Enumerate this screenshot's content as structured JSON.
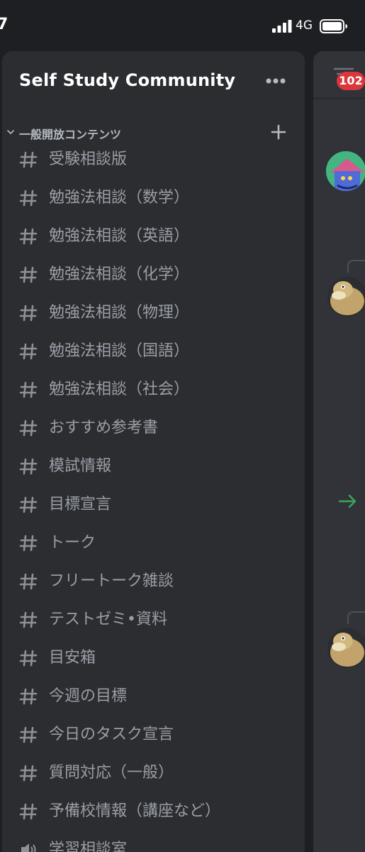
{
  "status_bar": {
    "time": "7",
    "network": "4G"
  },
  "server": {
    "name": "Self Study Community"
  },
  "category": {
    "label": "一般開放コンテンツ"
  },
  "channels": [
    {
      "label": "受験相談版",
      "type": "text"
    },
    {
      "label": "勉強法相談（数学）",
      "type": "text"
    },
    {
      "label": "勉強法相談（英語）",
      "type": "text"
    },
    {
      "label": "勉強法相談（化学）",
      "type": "text"
    },
    {
      "label": "勉強法相談（物理）",
      "type": "text"
    },
    {
      "label": "勉強法相談（国語）",
      "type": "text"
    },
    {
      "label": "勉強法相談（社会）",
      "type": "text"
    },
    {
      "label": "おすすめ参考書",
      "type": "text"
    },
    {
      "label": "模試情報",
      "type": "text"
    },
    {
      "label": "目標宣言",
      "type": "text"
    },
    {
      "label": "トーク",
      "type": "text"
    },
    {
      "label": "フリートーク雑談",
      "type": "text"
    },
    {
      "label": "テストゼミ•資料",
      "type": "text"
    },
    {
      "label": "目安箱",
      "type": "text"
    },
    {
      "label": "今週の目標",
      "type": "text"
    },
    {
      "label": "今日のタスク宣言",
      "type": "text"
    },
    {
      "label": "質問対応（一般）",
      "type": "text"
    },
    {
      "label": "予備校情報（講座など）",
      "type": "text"
    },
    {
      "label": "学習相談室",
      "type": "voice"
    }
  ],
  "chat": {
    "unread_badge": "102"
  },
  "colors": {
    "background": "#1e1f22",
    "panel": "#2b2d31",
    "chat": "#313338",
    "badge": "#da373c",
    "channel_text": "#9a9ea5",
    "join_arrow": "#3ba55d"
  },
  "icons": {
    "channel": "hash-icon",
    "voice": "speaker-icon",
    "more": "more-icon",
    "add": "plus-icon",
    "threads": "threads-icon"
  }
}
